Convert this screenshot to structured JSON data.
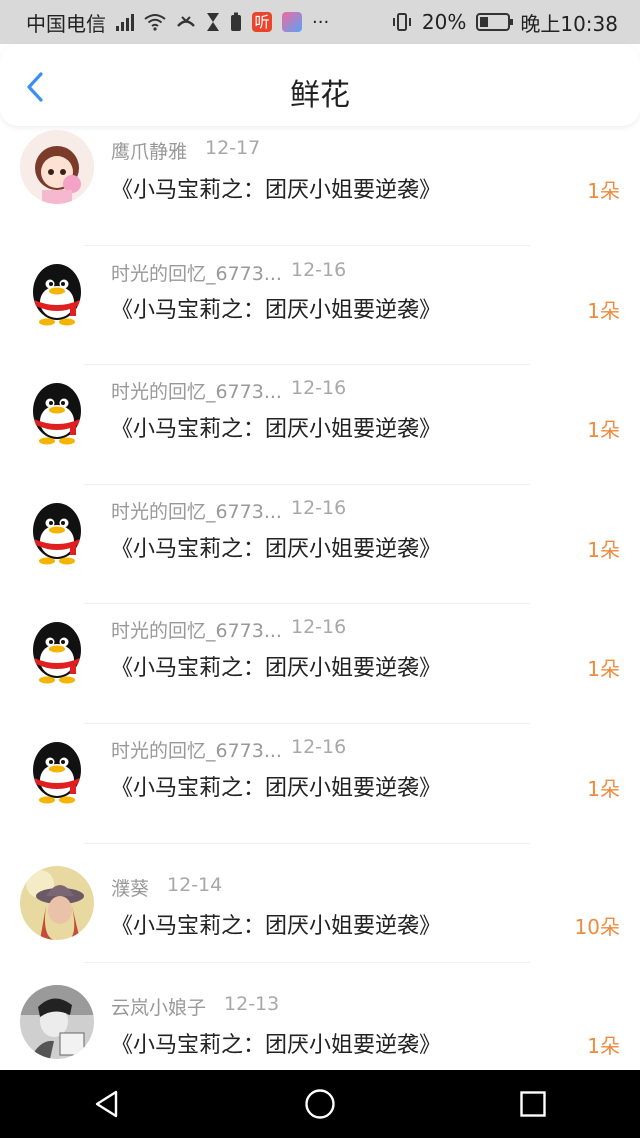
{
  "status_bar": {
    "carrier": "中国电信",
    "network": "4G",
    "battery": "20%",
    "time": "晚上10:38",
    "tag_listen": "听"
  },
  "header": {
    "title": "鲜花"
  },
  "colors": {
    "accent": "#3b8ff0",
    "count": "#f08a3c",
    "meta": "#999999"
  },
  "items": [
    {
      "name": "鹰爪静雅",
      "date": "12-17",
      "book": "《小马宝莉之：团厌小姐要逆袭》",
      "count": "1朵",
      "avatar": "cartoon-girl"
    },
    {
      "name": "时光的回忆_6773...",
      "date": "12-16",
      "book": "《小马宝莉之：团厌小姐要逆袭》",
      "count": "1朵",
      "avatar": "penguin"
    },
    {
      "name": "时光的回忆_6773...",
      "date": "12-16",
      "book": "《小马宝莉之：团厌小姐要逆袭》",
      "count": "1朵",
      "avatar": "penguin"
    },
    {
      "name": "时光的回忆_6773...",
      "date": "12-16",
      "book": "《小马宝莉之：团厌小姐要逆袭》",
      "count": "1朵",
      "avatar": "penguin"
    },
    {
      "name": "时光的回忆_6773...",
      "date": "12-16",
      "book": "《小马宝莉之：团厌小姐要逆袭》",
      "count": "1朵",
      "avatar": "penguin"
    },
    {
      "name": "时光的回忆_6773...",
      "date": "12-16",
      "book": "《小马宝莉之：团厌小姐要逆袭》",
      "count": "1朵",
      "avatar": "penguin"
    },
    {
      "name": "濮葵",
      "date": "12-14",
      "book": "《小马宝莉之：团厌小姐要逆袭》",
      "count": "10朵",
      "avatar": "photo-hat"
    },
    {
      "name": "云岚小娘子",
      "date": "12-13",
      "book": "《小马宝莉之：团厌小姐要逆袭》",
      "count": "1朵",
      "avatar": "photo-bw"
    }
  ]
}
